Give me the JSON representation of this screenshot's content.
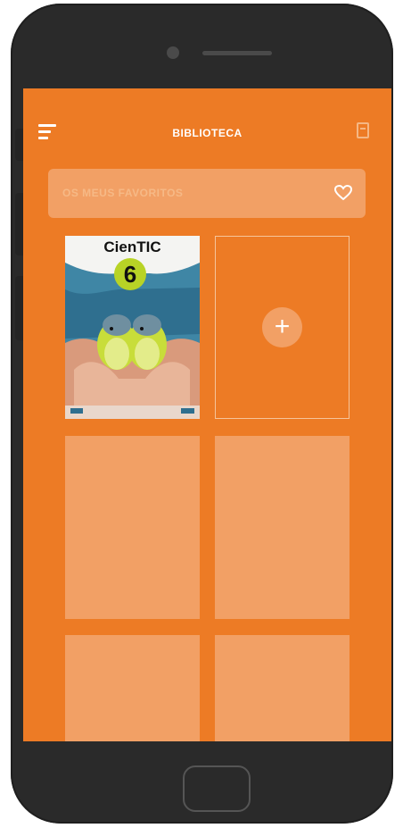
{
  "header": {
    "title": "BIBLIOTECA"
  },
  "favorites": {
    "label": "OS MEUS FAVORITOS"
  },
  "library": {
    "book": {
      "title": "CienTIC",
      "number": "6"
    },
    "add_label": "+"
  },
  "colors": {
    "screen_bg": "#ed7b25",
    "card_bg": "#f2a065",
    "phone_body": "#2a2a2a",
    "cover_accent": "#b8d326"
  },
  "icons": {
    "menu": "menu-icon",
    "book": "book-icon",
    "favorite": "heart-icon",
    "add": "plus-icon"
  }
}
